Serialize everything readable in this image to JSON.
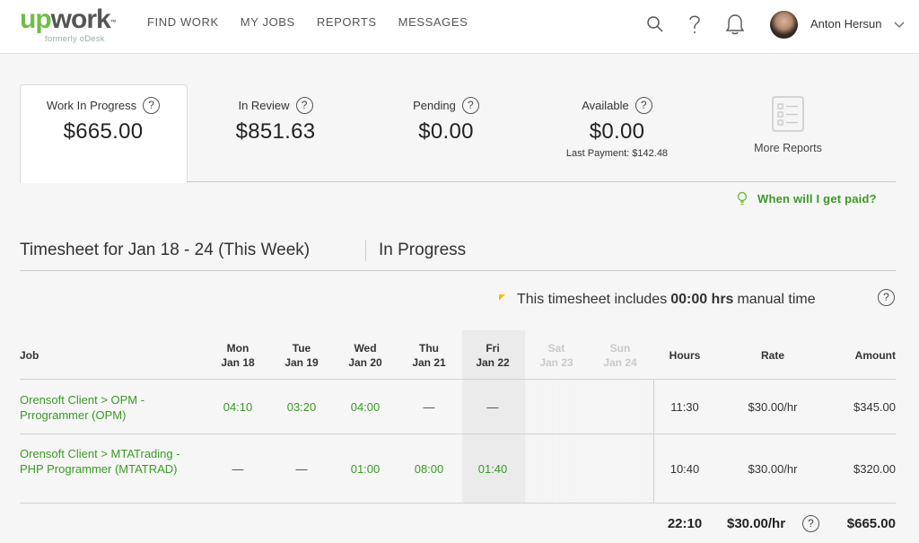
{
  "header": {
    "logo_up": "up",
    "logo_work": "work",
    "logo_tm": "™",
    "logo_sub": "formerly oDesk",
    "nav": [
      "FIND WORK",
      "MY JOBS",
      "REPORTS",
      "MESSAGES"
    ],
    "user_name": "Anton Hersun",
    "icons": [
      "search-icon",
      "help-icon",
      "bell-icon",
      "chevron-down-icon"
    ]
  },
  "summary": {
    "work_in_progress": {
      "label": "Work In Progress",
      "value": "$665.00"
    },
    "in_review": {
      "label": "In Review",
      "value": "$851.63"
    },
    "pending": {
      "label": "Pending",
      "value": "$0.00"
    },
    "available": {
      "label": "Available",
      "value": "$0.00",
      "sub": "Last Payment: $142.48"
    },
    "more_reports": "More Reports",
    "help_glyph": "?"
  },
  "paid_link": "When will I get paid?",
  "timesheet": {
    "title": "Timesheet for Jan 18 - 24 (This Week)",
    "status": "In Progress",
    "manual_note_pre": "This timesheet includes",
    "manual_note_bold": "00:00 hrs",
    "manual_note_post": "manual time"
  },
  "table": {
    "headers": {
      "job": "Job",
      "days": [
        {
          "day": "Mon",
          "date": "Jan 18"
        },
        {
          "day": "Tue",
          "date": "Jan 19"
        },
        {
          "day": "Wed",
          "date": "Jan 20"
        },
        {
          "day": "Thu",
          "date": "Jan 21"
        },
        {
          "day": "Fri",
          "date": "Jan 22"
        },
        {
          "day": "Sat",
          "date": "Jan 23"
        },
        {
          "day": "Sun",
          "date": "Jan 24"
        }
      ],
      "hours": "Hours",
      "rate": "Rate",
      "amount": "Amount"
    },
    "rows": [
      {
        "job": "Orensoft Client > OPM - Prrogrammer (OPM)",
        "mon": "04:10",
        "tue": "03:20",
        "wed": "04:00",
        "thu": "—",
        "fri": "—",
        "hours": "11:30",
        "rate": "$30.00/hr",
        "amount": "$345.00"
      },
      {
        "job": "Orensoft Client > MTATrading - PHP Programmer (MTATRAD)",
        "mon": "—",
        "tue": "—",
        "wed": "01:00",
        "thu": "08:00",
        "fri": "01:40",
        "hours": "10:40",
        "rate": "$30.00/hr",
        "amount": "$320.00"
      }
    ],
    "totals": {
      "hours": "22:10",
      "rate": "$30.00/hr",
      "amount": "$665.00"
    }
  },
  "colors": {
    "brand_green": "#6fbe44",
    "link_green": "#3a9a25",
    "manual_marker": "#f2c200"
  }
}
